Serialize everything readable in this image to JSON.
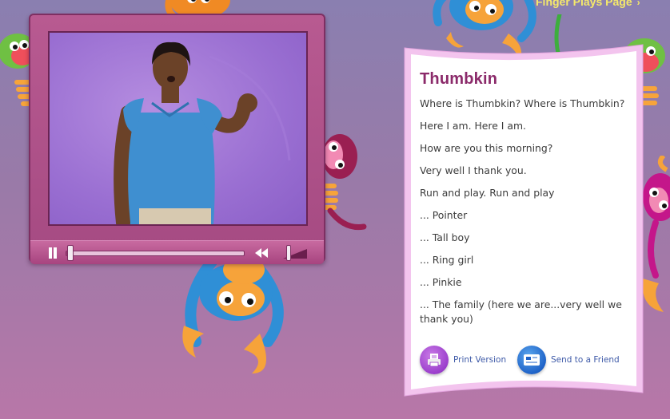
{
  "header": {
    "link_label": "Finger Plays Page",
    "link_arrow": "›"
  },
  "player": {
    "progress": 0.02,
    "volume": 0.5
  },
  "song": {
    "title": "Thumbkin",
    "lines": [
      "Where is Thumbkin? Where is Thumbkin?",
      "Here I am. Here I am.",
      "How are you this morning?",
      "Very well I thank you.",
      "Run and play.  Run and play",
      "... Pointer",
      "... Tall boy",
      "... Ring girl",
      "... Pinkie",
      "... The family (here we are...very well we thank you)"
    ]
  },
  "actions": {
    "print_label": "Print Version",
    "send_label": "Send to a Friend"
  },
  "icons": {
    "print": "printer-icon",
    "send": "email-card-icon",
    "pause": "pause-icon",
    "rewind": "rewind-icon",
    "volume": "volume-icon"
  },
  "colors": {
    "title": "#8b2a6a",
    "player": "#b85a91",
    "link": "#f5e96a",
    "action_link": "#3e5aa8"
  }
}
